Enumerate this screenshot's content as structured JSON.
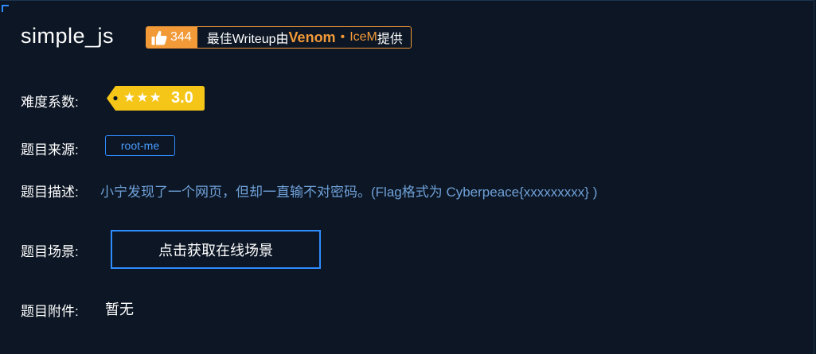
{
  "challenge": {
    "title": "simple_js"
  },
  "writeup": {
    "likes": "344",
    "prefix": "最佳Writeup由",
    "author_primary": "Venom",
    "separator": "•",
    "author_secondary": "IceM",
    "suffix": "提供",
    "badge_color": "#f29a38"
  },
  "difficulty": {
    "label": "难度系数:",
    "stars": "★★★",
    "score": "3.0",
    "tag_color": "#f5c518"
  },
  "source": {
    "label": "题目来源:",
    "value": "root-me"
  },
  "description": {
    "label": "题目描述:",
    "text": "小宁发现了一个网页，但却一直输不对密码。(Flag格式为 Cyberpeace{xxxxxxxxx} )"
  },
  "scene": {
    "label": "题目场景:",
    "button_label": "点击获取在线场景"
  },
  "attachment": {
    "label": "题目附件:",
    "value": "暂无"
  },
  "icons": {
    "thumb": "thumbs-up-icon",
    "corner": "corner-bracket-icon"
  },
  "colors": {
    "background": "#0c1624",
    "accent_blue": "#2f8cff",
    "description_text": "#6fa0d8"
  }
}
